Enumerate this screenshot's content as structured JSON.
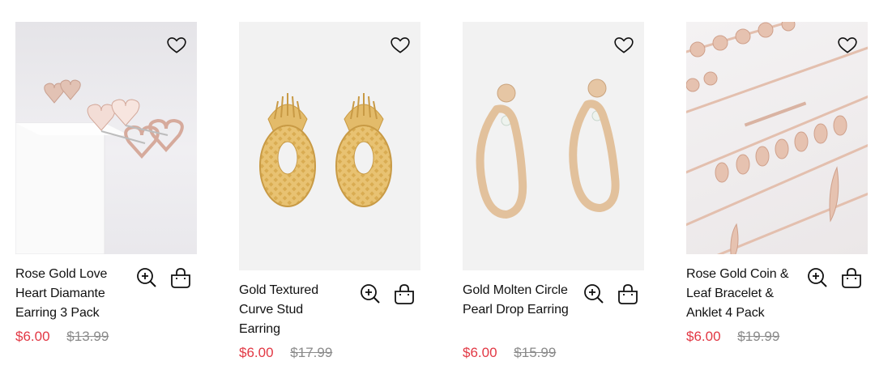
{
  "colors": {
    "sale": "#e23844",
    "was": "#8a8a8a",
    "text": "#111111"
  },
  "icons": {
    "wishlist": "heart-outline",
    "quick_view": "zoom-in",
    "add_to_bag": "shopping-bag"
  },
  "products": [
    {
      "title": "Rose Gold Love Heart Diamante Earring 3 Pack",
      "price": "$6.00",
      "was_price": "$13.99"
    },
    {
      "title": "Gold Textured Curve Stud Earring",
      "price": "$6.00",
      "was_price": "$17.99"
    },
    {
      "title": "Gold Molten Circle Pearl Drop Earring",
      "price": "$6.00",
      "was_price": "$15.99"
    },
    {
      "title": "Rose Gold Coin & Leaf Bracelet & Anklet 4 Pack",
      "price": "$6.00",
      "was_price": "$19.99"
    }
  ]
}
